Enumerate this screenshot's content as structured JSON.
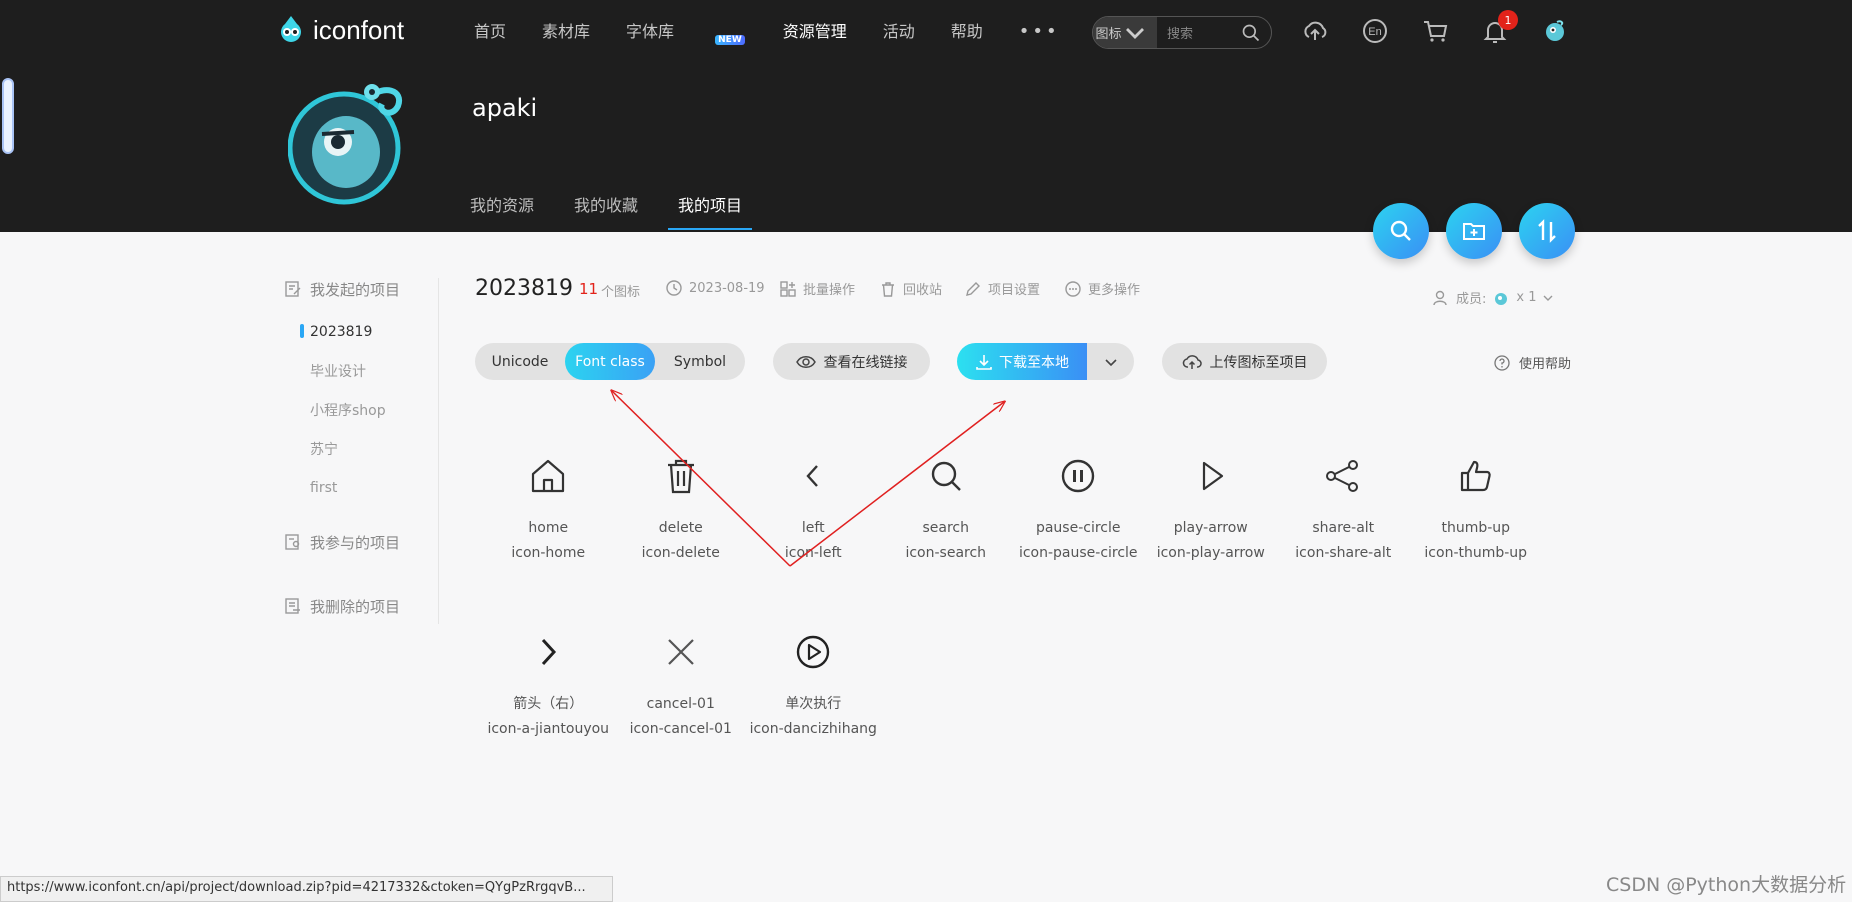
{
  "brand": {
    "name": "iconfont"
  },
  "nav": {
    "items": [
      "首页",
      "素材库",
      "字体库",
      "资源管理",
      "活动",
      "帮助"
    ],
    "new_badge": "NEW",
    "more": "•••"
  },
  "search": {
    "type": "图标",
    "placeholder": "搜索"
  },
  "header_icons": {
    "lang": "En",
    "notifications": "1"
  },
  "user": {
    "name": "apaki"
  },
  "subtabs": [
    "我的资源",
    "我的收藏",
    "我的项目"
  ],
  "sidebar": {
    "initiated": "我发起的项目",
    "projects": [
      "2023819",
      "毕业设计",
      "小程序shop",
      "苏宁",
      "first"
    ],
    "participated": "我参与的项目",
    "deleted": "我删除的项目"
  },
  "project": {
    "name": "2023819",
    "count": "11",
    "count_label": "个图标",
    "date": "2023-08-19",
    "batch": "批量操作",
    "recycle": "回收站",
    "settings": "项目设置",
    "more_ops": "更多操作",
    "members_label": "成员:",
    "members_count": "x 1"
  },
  "actions": {
    "tabs": [
      "Unicode",
      "Font class",
      "Symbol"
    ],
    "view_link": "查看在线链接",
    "download": "下载至本地",
    "upload": "上传图标至项目",
    "help": "使用帮助"
  },
  "icons": [
    {
      "name": "home",
      "cls": "icon-home",
      "glyph": "home-icon"
    },
    {
      "name": "delete",
      "cls": "icon-delete",
      "glyph": "delete-icon"
    },
    {
      "name": "left",
      "cls": "icon-left",
      "glyph": "left-icon"
    },
    {
      "name": "search",
      "cls": "icon-search",
      "glyph": "search-icon"
    },
    {
      "name": "pause-circle",
      "cls": "icon-pause-circle",
      "glyph": "pause-circle-icon"
    },
    {
      "name": "play-arrow",
      "cls": "icon-play-arrow",
      "glyph": "play-arrow-icon"
    },
    {
      "name": "share-alt",
      "cls": "icon-share-alt",
      "glyph": "share-alt-icon"
    },
    {
      "name": "thumb-up",
      "cls": "icon-thumb-up",
      "glyph": "thumb-up-icon"
    },
    {
      "name": "箭头（右）",
      "cls": "icon-a-jiantouyou",
      "glyph": "arrow-right-icon"
    },
    {
      "name": "cancel-01",
      "cls": "icon-cancel-01",
      "glyph": "cancel-icon"
    },
    {
      "name": "单次执行",
      "cls": "icon-dancizhihang",
      "glyph": "play-circle-icon"
    }
  ],
  "statusbar": "https://www.iconfont.cn/api/project/download.zip?pid=4217332&ctoken=QYgPzRrgqvB...",
  "watermark": "CSDN @Python大数据分析",
  "colors": {
    "accent": "#2aa7f5",
    "header_bg": "#1e1e1e",
    "annotation": "#e02020"
  }
}
